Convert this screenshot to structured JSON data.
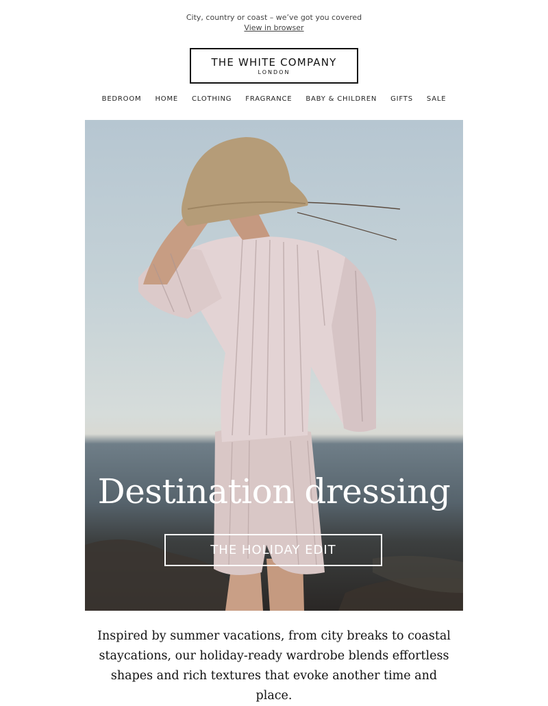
{
  "preheader": {
    "tagline": "City, country or coast – we’ve got you covered",
    "view_in_browser": "View in browser"
  },
  "logo": {
    "name": "THE WHITE COMPANY",
    "city": "LONDON"
  },
  "nav": {
    "items": [
      "BEDROOM",
      "HOME",
      "CLOTHING",
      "FRAGRANCE",
      "BABY & CHILDREN",
      "GIFTS",
      "SALE"
    ]
  },
  "hero": {
    "title": "Destination dressing",
    "cta": "THE HOLIDAY EDIT"
  },
  "intro": {
    "text": "Inspired by summer vacations, from city breaks to coastal staycations, our holiday-ready wardrobe blends effortless shapes and rich textures that evoke another time and place."
  }
}
